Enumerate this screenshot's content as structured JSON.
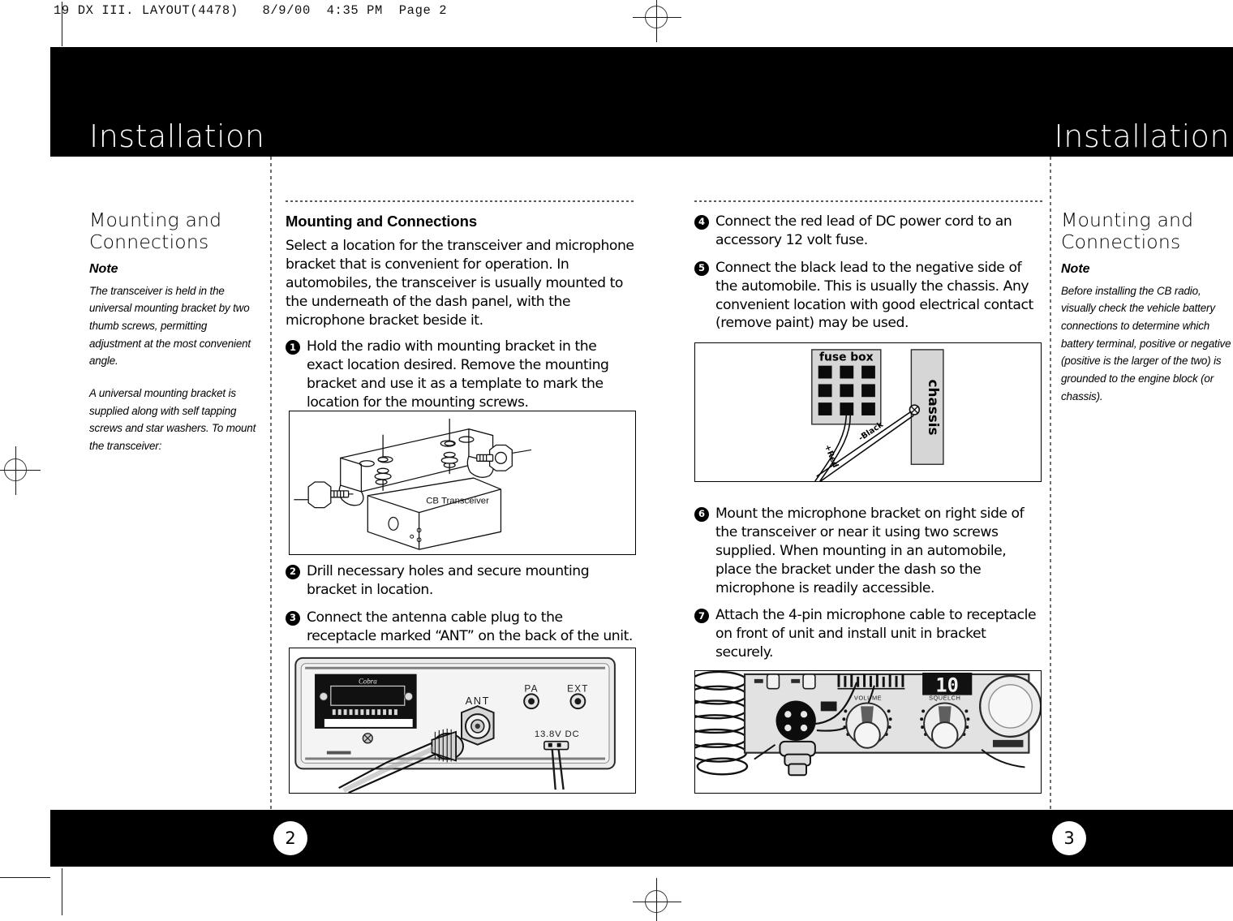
{
  "scan": {
    "slug": "19 DX III. LAYOUT(4478)   8/9/00  4:35 PM  Page 2"
  },
  "header": {
    "left_title": "Installation",
    "right_title": "Installation"
  },
  "footer": {
    "left_page": "2",
    "right_page": "3"
  },
  "left_sidebar": {
    "heading": "Mounting and Connections",
    "note_label": "Note",
    "paragraphs": [
      "The transceiver is held in the universal mounting bracket by two thumb screws, permitting adjustment at the most convenient angle.",
      "A universal mounting bracket is supplied along with self tapping screws and star washers. To mount the transceiver:"
    ]
  },
  "right_sidebar": {
    "heading": "Mounting and Connections",
    "note_label": "Note",
    "paragraphs": [
      "Before installing the CB radio, visually check the vehicle battery connections to determine which battery terminal, positive or negative (positive is the larger of the two) is grounded to the engine block (or chassis)."
    ]
  },
  "left_page": {
    "heading": "Mounting and Connections",
    "intro": "Select a location for the transceiver and microphone bracket that is convenient for operation. In automobiles, the transceiver is usually mounted to the underneath of the dash panel, with the microphone bracket beside it.",
    "steps": [
      {
        "num": "1",
        "text": "Hold the radio with mounting bracket in the exact location desired. Remove the mounting bracket and use it as a template to mark the location for the mounting screws."
      },
      {
        "num": "2",
        "text": "Drill necessary holes and secure mounting bracket in location."
      },
      {
        "num": "3",
        "text": "Connect the antenna cable plug to the receptacle marked “ANT” on the back of the unit."
      }
    ]
  },
  "right_page": {
    "steps": [
      {
        "num": "4",
        "text": "Connect the red lead of DC power cord to an accessory 12 volt fuse."
      },
      {
        "num": "5",
        "text": "Connect the black lead to the negative side of the automobile. This is usually the chassis. Any convenient location with good electrical contact (remove paint) may be used."
      },
      {
        "num": "6",
        "text": "Mount the microphone bracket on right side of the transceiver or near it using two screws supplied. When mounting in an automobile, place the bracket under the dash so the microphone is readily accessible."
      },
      {
        "num": "7",
        "text": "Attach the 4-pin microphone cable to receptacle on front of unit and install unit in bracket securely."
      }
    ]
  },
  "figures": {
    "bracket": {
      "caption": "CB Transceiver"
    },
    "rear_panel": {
      "brand": "Cobra",
      "ant_label": "ANT",
      "pa_label": "PA",
      "ext_label": "EXT",
      "dc_label": "13.8V DC"
    },
    "fuse": {
      "fuse_box_label": "fuse box",
      "chassis_label": "chassis",
      "red_label": "+Red",
      "black_label": "-Black"
    },
    "front_panel": {
      "channel_display": "10"
    }
  },
  "colors": {
    "band": "#000000",
    "paper": "#ffffff",
    "rule": "#6f6f6f",
    "figure_fill": "#d9d9d9"
  }
}
